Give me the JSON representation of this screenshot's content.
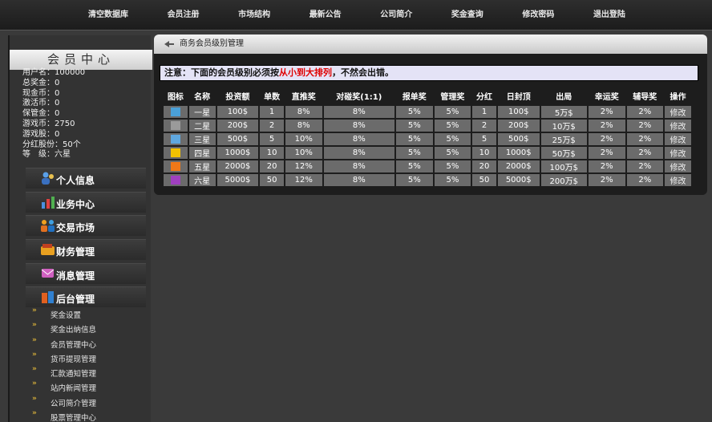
{
  "nav": [
    "清空数据库",
    "会员注册",
    "市场结构",
    "最新公告",
    "公司简介",
    "奖金查询",
    "修改密码",
    "退出登陆"
  ],
  "sidebar": {
    "title": "会员中心",
    "userinfo": [
      "用户名：100000",
      "总奖金：0",
      "现金币：0",
      "激活币：0",
      "保管金：0",
      "游戏币：2750",
      "游戏股：0",
      "分红股份：50个",
      "等　级：六星"
    ],
    "menu": [
      {
        "label": "个人信息",
        "icon": "person-icon"
      },
      {
        "label": "业务中心",
        "icon": "chart-icon"
      },
      {
        "label": "交易市场",
        "icon": "people-icon"
      },
      {
        "label": "财务管理",
        "icon": "wallet-icon"
      },
      {
        "label": "消息管理",
        "icon": "message-icon"
      },
      {
        "label": "后台管理",
        "icon": "admin-icon"
      }
    ],
    "submenu": [
      "奖金设置",
      "奖金出纳信息",
      "会员管理中心",
      "货币提现管理",
      "汇款通知管理",
      "站内新闻管理",
      "公司简介管理",
      "股票管理中心"
    ]
  },
  "panel": {
    "title": "商务会员级别管理",
    "notice_prefix": "注意：下面的会员级别必须按",
    "notice_highlight": "从小到大排列",
    "notice_suffix": "，不然会出错。"
  },
  "table": {
    "headers": [
      "图标",
      "名称",
      "投资额",
      "单数",
      "直推奖",
      "对碰奖(1:1)",
      "报单奖",
      "管理奖",
      "分红",
      "日封顶",
      "出局",
      "幸运奖",
      "辅导奖",
      "操作"
    ],
    "rows": [
      {
        "icon_color": "#4aa0d8",
        "cells": [
          "一星",
          "100$",
          "1",
          "8%",
          "8%",
          "5%",
          "5%",
          "1",
          "100$",
          "5万$",
          "2%",
          "2%",
          "修改"
        ]
      },
      {
        "icon_color": "#9a9a9a",
        "cells": [
          "二星",
          "200$",
          "2",
          "8%",
          "8%",
          "5%",
          "5%",
          "2",
          "200$",
          "10万$",
          "2%",
          "2%",
          "修改"
        ]
      },
      {
        "icon_color": "#5fa8e0",
        "cells": [
          "三星",
          "500$",
          "5",
          "10%",
          "8%",
          "5%",
          "5%",
          "5",
          "500$",
          "25万$",
          "2%",
          "2%",
          "修改"
        ]
      },
      {
        "icon_color": "#f2c200",
        "cells": [
          "四星",
          "1000$",
          "10",
          "10%",
          "8%",
          "5%",
          "5%",
          "10",
          "1000$",
          "50万$",
          "2%",
          "2%",
          "修改"
        ]
      },
      {
        "icon_color": "#f07818",
        "cells": [
          "五星",
          "2000$",
          "20",
          "12%",
          "8%",
          "5%",
          "5%",
          "20",
          "2000$",
          "100万$",
          "2%",
          "2%",
          "修改"
        ]
      },
      {
        "icon_color": "#a040c0",
        "cells": [
          "六星",
          "5000$",
          "50",
          "12%",
          "8%",
          "5%",
          "5%",
          "50",
          "5000$",
          "200万$",
          "2%",
          "2%",
          "修改"
        ]
      }
    ]
  }
}
